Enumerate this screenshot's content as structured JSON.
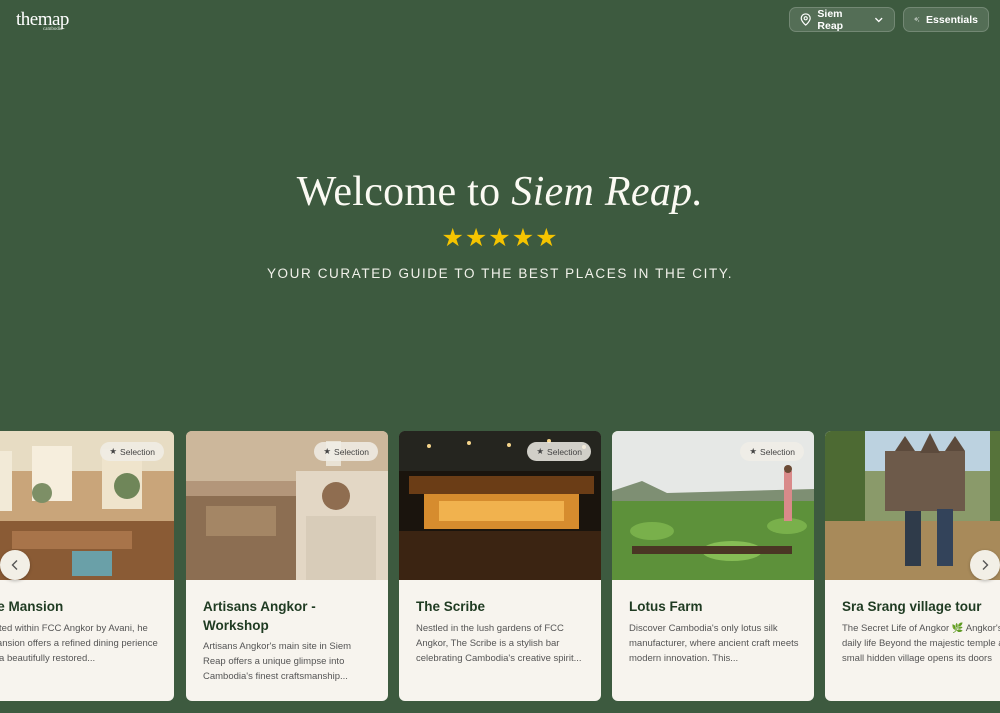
{
  "header": {
    "logo": "themap",
    "logo_sub": "cambodia",
    "city_label": "Siem Reap",
    "essentials_label": "Essentials"
  },
  "hero": {
    "title_prefix": "Welcome to",
    "title_city": "Siem Reap.",
    "stars": "★★★★★",
    "subtitle": "YOUR CURATED GUIDE TO THE BEST PLACES IN THE CITY."
  },
  "cards": [
    {
      "badge": "Selection",
      "title": "he Mansion",
      "desc": "cated within FCC Angkor by Avani, he Mansion offers a refined dining perience in a beautifully restored..."
    },
    {
      "badge": "Selection",
      "title": "Artisans Angkor - Workshop",
      "desc": "Artisans Angkor's main site in Siem Reap offers a unique glimpse into Cambodia's finest craftsmanship..."
    },
    {
      "badge": "Selection",
      "title": "The Scribe",
      "desc": "Nestled in the lush gardens of FCC Angkor, The Scribe is a stylish bar celebrating Cambodia's creative spirit..."
    },
    {
      "badge": "Selection",
      "title": "Lotus Farm",
      "desc": "Discover Cambodia's only lotus silk manufacturer, where ancient craft meets modern innovation. This..."
    },
    {
      "badge": "",
      "title": "Sra Srang village tour",
      "desc": "The Secret Life of Angkor 🌿 Angkor's daily life Beyond the majestic temple a small hidden village opens its doors"
    }
  ],
  "colors": {
    "background": "#3d5a3f",
    "card": "#f7f4ee",
    "star": "#f5c400"
  }
}
